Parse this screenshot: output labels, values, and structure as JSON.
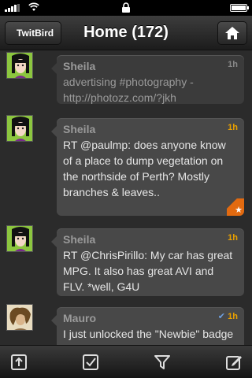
{
  "nav": {
    "back_label": "TwitBird",
    "title": "Home (172)"
  },
  "tweets": [
    {
      "user": "Sheila",
      "time": "1h",
      "text": "advertising #photography - http://photozz.com/?jkh",
      "read": true
    },
    {
      "user": "Sheila",
      "time": "1h",
      "text": "RT @paulmp: does anyone know of a place to dump vegetation on the northside of Perth? Mostly branches & leaves..",
      "starred": true
    },
    {
      "user": "Sheila",
      "time": "1h",
      "text": "RT @ChrisPirillo: My car has great MPG. It also has great AVI and FLV. *well, G4U"
    },
    {
      "user": "Mauro",
      "time": "1h",
      "text": "I just unlocked the \"Newbie\" badge on @foursquare!",
      "checked": true
    }
  ],
  "toolbar": [
    "compose-upload-icon",
    "checkmark-icon",
    "filter-icon",
    "edit-icon"
  ],
  "colors": {
    "accent": "#e8a000",
    "star": "#e26a10"
  }
}
